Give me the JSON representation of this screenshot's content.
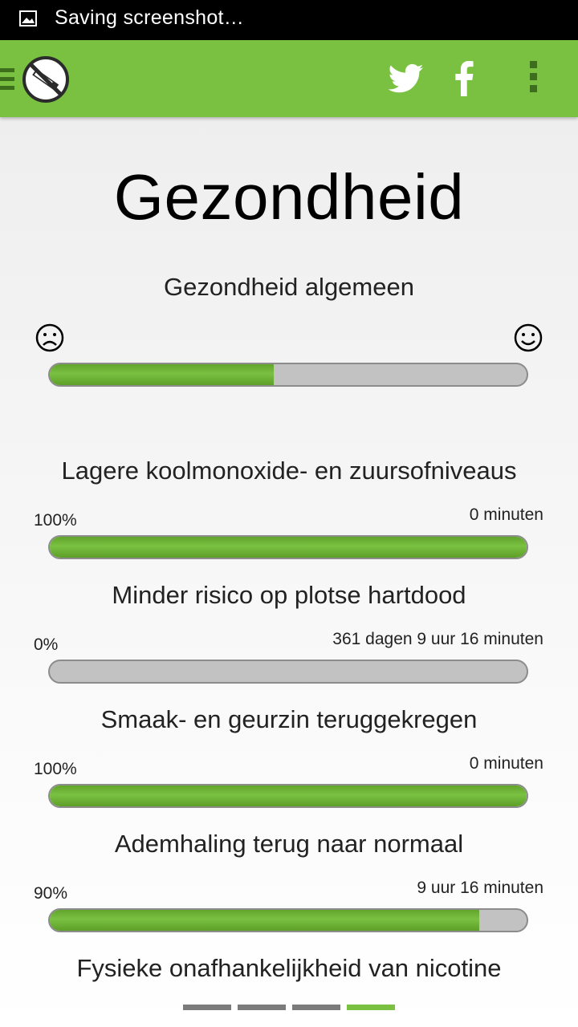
{
  "status_bar": {
    "text": "Saving screenshot…",
    "icon": "image-icon"
  },
  "app_bar": {
    "logo": "no-smoking-logo",
    "actions": [
      "twitter-icon",
      "facebook-icon",
      "overflow-menu-icon"
    ],
    "accent": "#7ac142"
  },
  "page": {
    "title": "Gezondheid",
    "general": {
      "title": "Gezondheid algemeen",
      "left_face": "sad-face-icon",
      "right_face": "happy-face-icon",
      "progress": 0.47
    },
    "items": [
      {
        "title": "Lagere koolmonoxide- en zuursofniveaus",
        "percent": "100%",
        "time": "0 minuten",
        "progress": 1.0
      },
      {
        "title": "Minder risico op plotse hartdood",
        "percent": "0%",
        "time": "361 dagen 9 uur 16 minuten",
        "progress": 0.0
      },
      {
        "title": "Smaak- en geurzin teruggekregen",
        "percent": "100%",
        "time": "0 minuten",
        "progress": 1.0
      },
      {
        "title": "Ademhaling terug naar normaal",
        "percent": "90%",
        "time": "9 uur 16 minuten",
        "progress": 0.9
      },
      {
        "title": "Fysieke onafhankelijkheid van nicotine"
      }
    ]
  },
  "pager": {
    "count": 4,
    "active_index": 3
  }
}
